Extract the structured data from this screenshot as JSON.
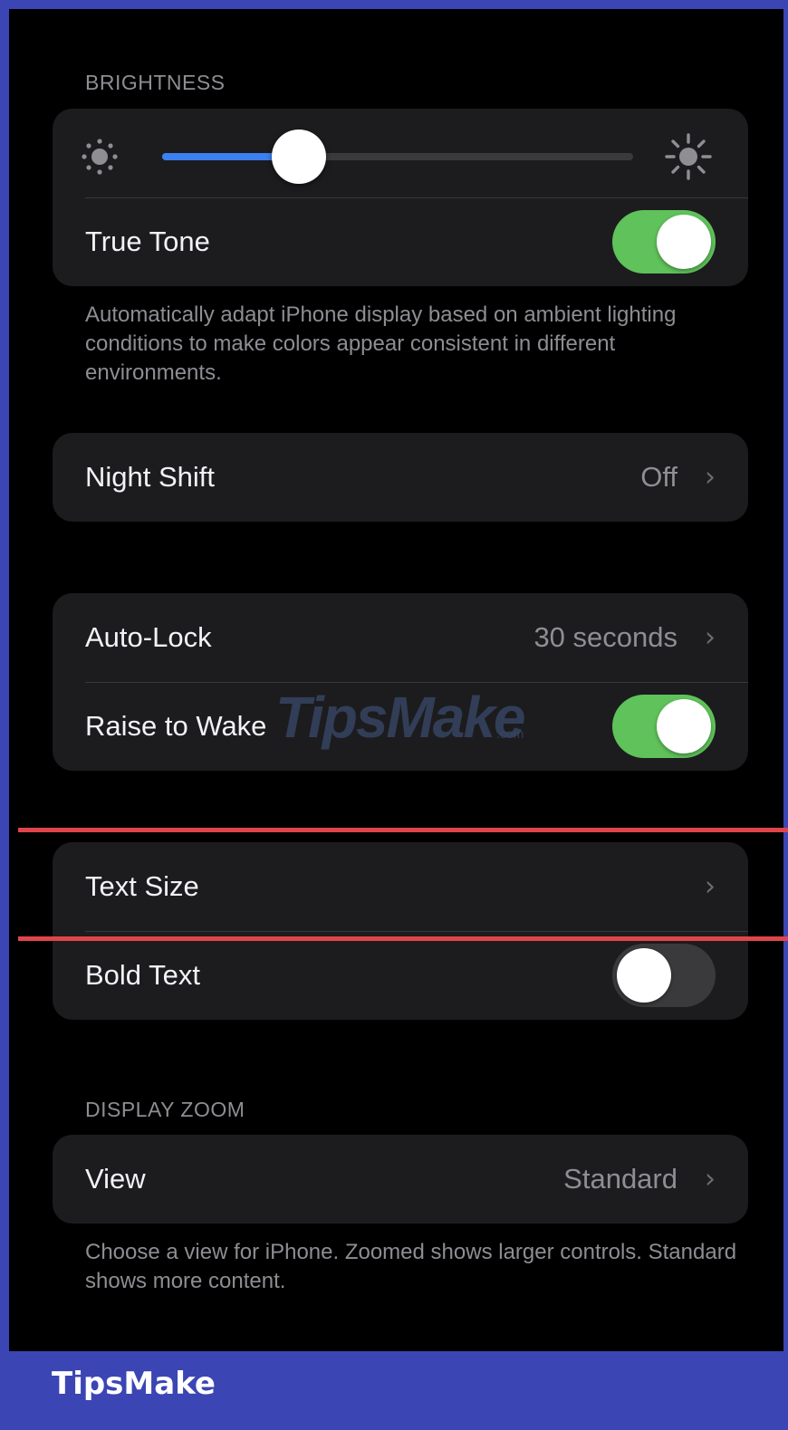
{
  "brightness": {
    "header": "BRIGHTNESS",
    "level": 0.29,
    "true_tone_label": "True Tone",
    "true_tone_on": true,
    "footer": "Automatically adapt iPhone display based on ambient lighting conditions to make colors appear consistent in different environments."
  },
  "night_shift": {
    "label": "Night Shift",
    "value": "Off"
  },
  "lock": {
    "auto_lock_label": "Auto-Lock",
    "auto_lock_value": "30 seconds",
    "raise_to_wake_label": "Raise to Wake",
    "raise_to_wake_on": true
  },
  "text": {
    "text_size_label": "Text Size",
    "bold_text_label": "Bold Text",
    "bold_text_on": false
  },
  "display_zoom": {
    "header": "DISPLAY ZOOM",
    "view_label": "View",
    "view_value": "Standard",
    "footer": "Choose a view for iPhone. Zoomed shows larger controls. Standard shows more content."
  },
  "icons": {
    "chevron": "chevron-right-icon",
    "sun_small": "sun-small-icon",
    "sun_large": "sun-large-icon"
  },
  "colors": {
    "toggle_on": "#5fc25a",
    "toggle_off": "#3a3a3c",
    "slider_fill": "#3d80f0",
    "frame": "#3b45b4",
    "highlight": "#e0454a"
  },
  "watermark": "TipsMake",
  "brand": "TipsMake"
}
